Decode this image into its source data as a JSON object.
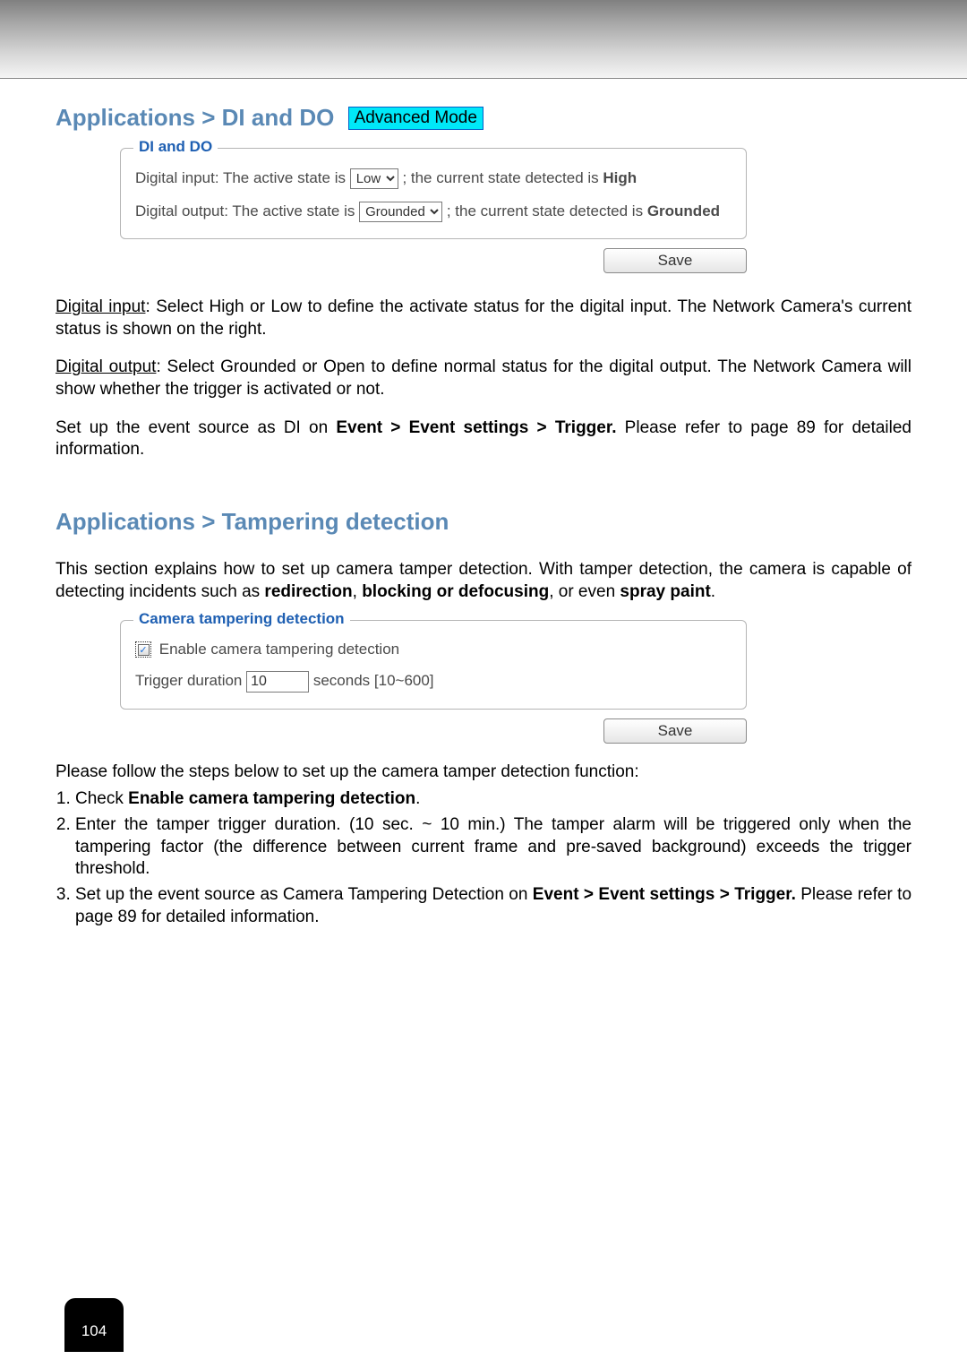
{
  "section1": {
    "title": "Applications > DI and DO",
    "badge": "Advanced Mode",
    "fieldset_legend": "DI and DO",
    "di": {
      "label_before": "Digital input: The active state is ",
      "select_value": "Low",
      "label_mid": " ; the current state detected is ",
      "state": "High"
    },
    "do": {
      "label_before": "Digital output: The active state is ",
      "select_value": "Grounded",
      "label_mid": " ; the current state detected is ",
      "state": "Grounded"
    },
    "save": "Save",
    "para1_underline": "Digital input",
    "para1_rest": ": Select High or Low to define the activate status for the digital input. The Network Camera's current status is shown on the right.",
    "para2_underline": "Digital output",
    "para2_rest": ": Select Grounded or Open to define normal status for the digital output. The Network Camera will show whether the trigger is activated or not.",
    "para3_pre": "Set up the event source as DI on ",
    "para3_bold": "Event > Event settings > Trigger.",
    "para3_post": " Please refer to page 89 for detailed information."
  },
  "section2": {
    "title": "Applications > Tampering detection",
    "intro_pre": "This section explains how to set up camera tamper detection. With tamper detection, the camera is capable of detecting incidents such as ",
    "intro_bold1": "redirection",
    "intro_mid": ", ",
    "intro_bold2": "blocking or defocusing",
    "intro_post": ", or even ",
    "intro_bold3": "spray paint",
    "intro_end": ".",
    "fieldset_legend": "Camera tampering detection",
    "checkbox_label": " Enable camera tampering detection",
    "trigger_label": "Trigger duration ",
    "trigger_value": "10",
    "trigger_suffix": " seconds [10~600]",
    "save": "Save",
    "follow": "Please follow the steps below to set up the camera tamper detection function:",
    "step1_pre": "Check ",
    "step1_bold": "Enable camera tampering detection",
    "step1_post": ".",
    "step2": "Enter the tamper trigger duration. (10 sec. ~ 10 min.) The tamper alarm will be triggered only when the tampering factor (the difference between current frame and pre-saved background) exceeds the trigger threshold.",
    "step3_pre": "Set up the event source as Camera Tampering Detection on ",
    "step3_bold": "Event > Event settings > Trigger.",
    "step3_post": " Please refer to page 89 for detailed information."
  },
  "page_number": "104"
}
